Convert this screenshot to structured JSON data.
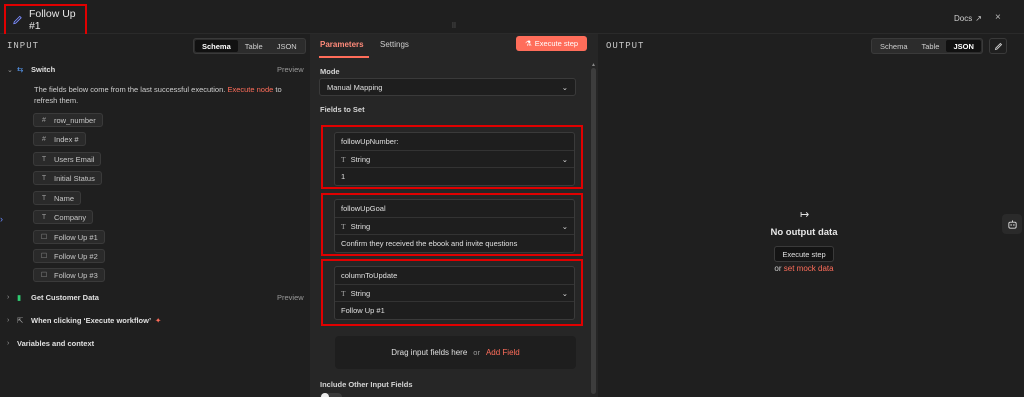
{
  "header": {
    "title": "Follow Up #1",
    "docs_label": "Docs",
    "close_label": "×"
  },
  "input": {
    "section_label": "INPUT",
    "view_modes": [
      "Schema",
      "Table",
      "JSON"
    ],
    "active_view": "Schema",
    "switch_node": {
      "label": "Switch",
      "preview": "Preview",
      "note_before": "The fields below come from the last successful execution.",
      "note_link": "Execute node",
      "note_after": "to refresh them."
    },
    "fields": [
      {
        "icon": "#",
        "label": "row_number"
      },
      {
        "icon": "#",
        "label": "Index #"
      },
      {
        "icon": "T",
        "label": "Users Email"
      },
      {
        "icon": "T",
        "label": "Initial Status"
      },
      {
        "icon": "T",
        "label": "Name"
      },
      {
        "icon": "T",
        "label": "Company"
      },
      {
        "icon": "☐",
        "label": "Follow Up #1"
      },
      {
        "icon": "☐",
        "label": "Follow Up #2"
      },
      {
        "icon": "☐",
        "label": "Follow Up #3"
      }
    ],
    "get_customer_data": {
      "label": "Get Customer Data",
      "preview": "Preview"
    },
    "manual_trigger": {
      "label": "When clicking ‘Execute workflow’"
    },
    "variables": {
      "label": "Variables and context"
    }
  },
  "params": {
    "tabs": [
      "Parameters",
      "Settings"
    ],
    "active_tab": "Parameters",
    "execute_step": "Execute step",
    "mode_label": "Mode",
    "mode_value": "Manual Mapping",
    "fields_label": "Fields to Set",
    "assignments": [
      {
        "name": "followUpNumber:",
        "type": "String",
        "value": "1"
      },
      {
        "name": "followUpGoal",
        "type": "String",
        "value": "Confirm they received the ebook and invite questions"
      },
      {
        "name": "columnToUpdate",
        "type": "String",
        "value": "Follow Up #1"
      }
    ],
    "drag_text": "Drag input fields here",
    "drag_or": "or",
    "add_field": "Add Field",
    "include_label": "Include Other Input Fields"
  },
  "output": {
    "section_label": "OUTPUT",
    "view_modes": [
      "Schema",
      "Table",
      "JSON"
    ],
    "active_view": "JSON",
    "no_output": "No output data",
    "execute_step": "Execute step",
    "or": "or",
    "mock_link": "set mock data"
  },
  "colors": {
    "accent": "#ff6d5a",
    "highlight_outline": "#e00000",
    "background": "#1f1f1f"
  }
}
